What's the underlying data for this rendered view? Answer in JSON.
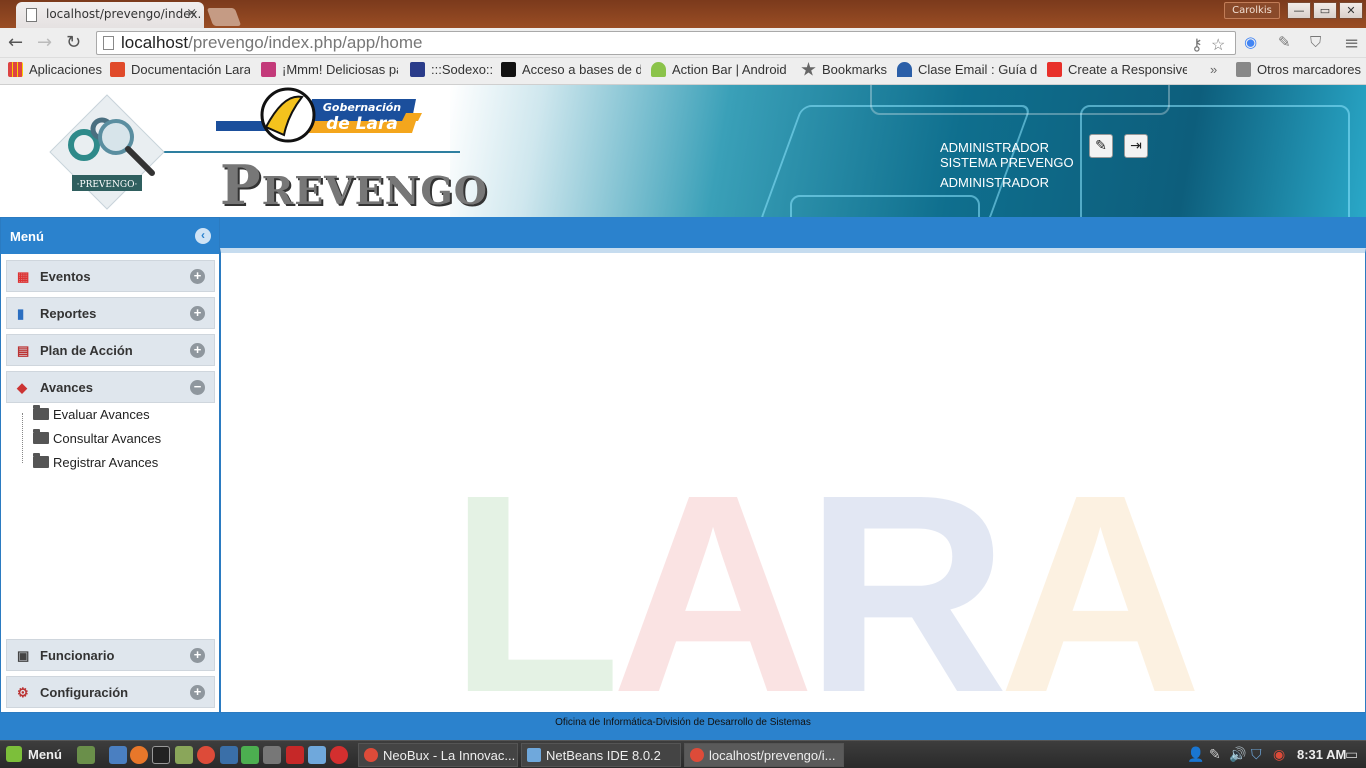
{
  "browser": {
    "active_tab_title": "localhost/prevengo/index.",
    "tab_close": "×",
    "profile_name": "Carolkis",
    "window_minimize": "—",
    "window_restore": "▭",
    "window_close": "✕",
    "back": "←",
    "forward": "→",
    "reload": "↻",
    "url_host": "localhost",
    "url_path": "/prevengo/index.php/app/home",
    "star": "☆",
    "key": "⚷",
    "overflow": "»"
  },
  "bookmarks": {
    "items": [
      {
        "label": "Aplicaciones",
        "color": "#d44"
      },
      {
        "label": "Documentación Lara",
        "color": "#e04a2a"
      },
      {
        "label": "¡Mmm! Deliciosas pa",
        "color": "#c33a7a"
      },
      {
        "label": ":::Sodexo::.",
        "color": "#2a3c8a"
      },
      {
        "label": "Acceso a bases de da",
        "color": "#111111"
      },
      {
        "label": "Action Bar | Android",
        "color": "#8bc34a"
      },
      {
        "label": "Bookmarks",
        "color": "#666666"
      },
      {
        "label": "Clase Email : Guía de",
        "color": "#2b5fa8"
      },
      {
        "label": "Create a Responsive",
        "color": "#e8302a"
      }
    ],
    "other": "Otros marcadores"
  },
  "header": {
    "gob_line1": "Gobernación",
    "gob_line2": "de Lara",
    "brand_first": "P",
    "brand_rest": "REVENGO",
    "logo_label": "·PREVENGO·",
    "user_role": "ADMINISTRADOR",
    "user_system": "SISTEMA PREVENGO",
    "user_name": "ADMINISTRADOR",
    "profile_icon": "✎",
    "logout_icon": "⇥"
  },
  "menu": {
    "title": "Menú",
    "collapse_icon": "‹",
    "sections": [
      {
        "label": "Eventos",
        "icon": "▦",
        "toggle": "+"
      },
      {
        "label": "Reportes",
        "icon": "▮",
        "toggle": "+"
      },
      {
        "label": "Plan de Acción",
        "icon": "▤",
        "toggle": "+"
      },
      {
        "label": "Avances",
        "icon": "◆",
        "toggle": "−"
      }
    ],
    "avances_items": [
      "Evaluar Avances",
      "Consultar Avances",
      "Registrar Avances"
    ],
    "bottom_sections": [
      {
        "label": "Funcionario",
        "icon": "▣",
        "toggle": "+"
      },
      {
        "label": "Configuración",
        "icon": "⚙",
        "toggle": "+"
      }
    ]
  },
  "content": {
    "watermark_letters": [
      {
        "letter": "L",
        "color": "#4aa84a"
      },
      {
        "letter": "A",
        "color": "#e04040"
      },
      {
        "letter": "R",
        "color": "#3a5fb0"
      },
      {
        "letter": "A",
        "color": "#f0a030"
      }
    ]
  },
  "footer": {
    "text": "Oficina de Informática-División de Desarrollo de Sistemas"
  },
  "taskbar": {
    "start_label": "Menú",
    "tasks": [
      "NeoBux - La Innovac...",
      "NetBeans IDE 8.0.2",
      "localhost/prevengo/i..."
    ],
    "clock": "8:31 AM"
  }
}
